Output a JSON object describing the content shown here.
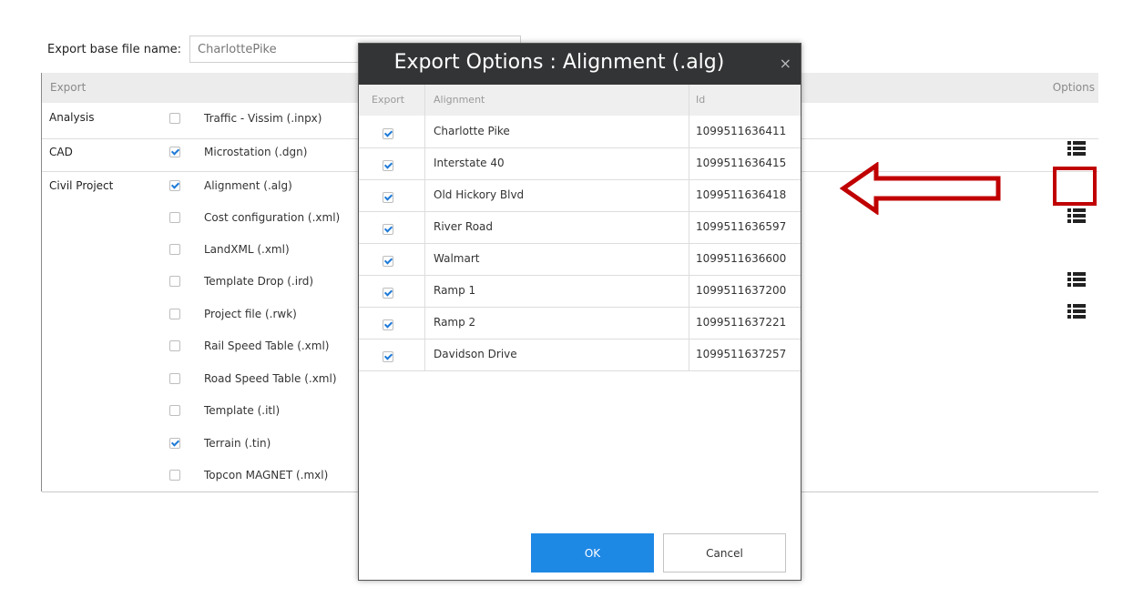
{
  "form": {
    "base_name_label": "Export base file name:",
    "base_name_value": "CharlottePike"
  },
  "table": {
    "header_export": "Export",
    "header_options": "Options",
    "groups": [
      "Analysis",
      "CAD",
      "Civil Project"
    ],
    "rows": [
      {
        "label": "Traffic - Vissim (.inpx)",
        "checked": false,
        "has_options": true
      },
      {
        "label": "Microstation (.dgn)",
        "checked": true,
        "has_options": false
      },
      {
        "label": "Alignment (.alg)",
        "checked": true,
        "has_options": true,
        "highlighted": true
      },
      {
        "label": "Cost configuration (.xml)",
        "checked": false,
        "has_options": false
      },
      {
        "label": "LandXML (.xml)",
        "checked": false,
        "has_options": true
      },
      {
        "label": "Template Drop (.ird)",
        "checked": false,
        "has_options": true
      },
      {
        "label": "Project file (.rwk)",
        "checked": false,
        "has_options": false
      },
      {
        "label": "Rail Speed Table (.xml)",
        "checked": false,
        "has_options": false
      },
      {
        "label": "Road Speed Table (.xml)",
        "checked": false,
        "has_options": false
      },
      {
        "label": "Template (.itl)",
        "checked": false,
        "has_options": false
      },
      {
        "label": "Terrain (.tin)",
        "checked": true,
        "has_options": false
      },
      {
        "label": "Topcon MAGNET (.mxl)",
        "checked": false,
        "has_options": false
      }
    ]
  },
  "dialog": {
    "title": "Export Options : Alignment (.alg)",
    "close_glyph": "×",
    "columns": {
      "export": "Export",
      "alignment": "Alignment",
      "id": "Id"
    },
    "rows": [
      {
        "name": "Charlotte Pike",
        "id": "1099511636411",
        "checked": true
      },
      {
        "name": "Interstate 40",
        "id": "1099511636415",
        "checked": true
      },
      {
        "name": "Old Hickory Blvd",
        "id": "1099511636418",
        "checked": true
      },
      {
        "name": "River Road",
        "id": "1099511636597",
        "checked": true
      },
      {
        "name": "Walmart",
        "id": "1099511636600",
        "checked": true
      },
      {
        "name": "Ramp 1",
        "id": "1099511637200",
        "checked": true
      },
      {
        "name": "Ramp 2",
        "id": "1099511637221",
        "checked": true
      },
      {
        "name": "Davidson Drive",
        "id": "1099511637257",
        "checked": true
      }
    ],
    "ok_label": "OK",
    "cancel_label": "Cancel"
  },
  "colors": {
    "accent": "#1e88e5",
    "highlight": "#c00000",
    "title_bar": "#333436",
    "check": "#1f7ad8"
  },
  "icons": {
    "options": "list-icon",
    "annotation": "left-arrow-icon"
  }
}
